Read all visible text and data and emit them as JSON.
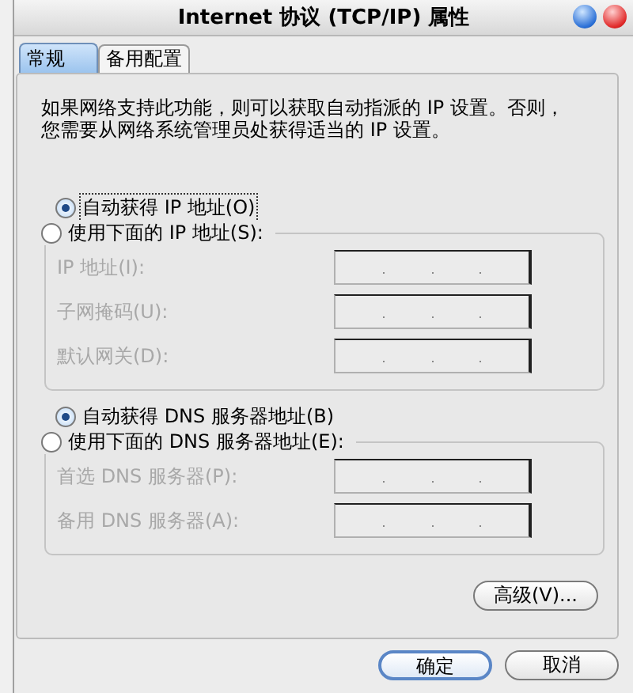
{
  "window": {
    "title": "Internet 协议 (TCP/IP) 属性"
  },
  "tabs": [
    {
      "label": "常规",
      "selected": true
    },
    {
      "label": "备用配置",
      "selected": false
    }
  ],
  "intro": [
    "如果网络支持此功能，则可以获取自动指派的 IP 设置。否则，",
    "您需要从网络系统管理员处获得适当的 IP 设置。"
  ],
  "groups": [
    {
      "options": [
        {
          "label": "自动获得 IP 地址(O)",
          "selected": true,
          "focused": true
        },
        {
          "label": "使用下面的 IP 地址(S):",
          "selected": false,
          "focused": false
        }
      ],
      "fields": [
        {
          "label": "IP 地址(I):",
          "disabled": true
        },
        {
          "label": "子网掩码(U):",
          "disabled": true
        },
        {
          "label": "默认网关(D):",
          "disabled": true
        }
      ]
    },
    {
      "options": [
        {
          "label": "自动获得 DNS 服务器地址(B)",
          "selected": true,
          "focused": false
        },
        {
          "label": "使用下面的 DNS 服务器地址(E):",
          "selected": false,
          "focused": false
        }
      ],
      "fields": [
        {
          "label": "首选 DNS 服务器(P):",
          "disabled": true
        },
        {
          "label": "备用 DNS 服务器(A):",
          "disabled": true
        }
      ]
    }
  ],
  "advanced_button": "高级(V)...",
  "buttons": [
    {
      "label": "确定",
      "default": true
    },
    {
      "label": "取消",
      "default": false
    }
  ]
}
